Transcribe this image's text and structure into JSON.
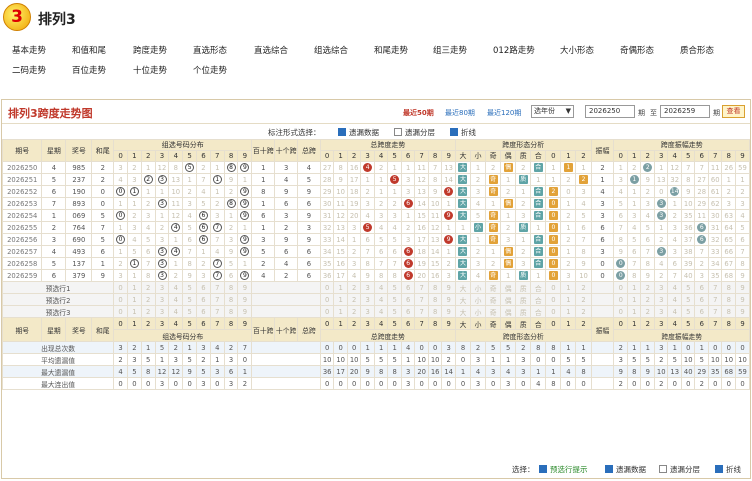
{
  "app": {
    "logo_text": "3",
    "title": "排列3"
  },
  "nav": [
    [
      "基本走势",
      "和值和尾",
      "跨度走势",
      "直选形态",
      "直选综合",
      "组选综合",
      "和尾走势",
      "组三走势",
      "012路走势",
      "大小形态",
      "奇偶形态",
      "质合形态"
    ],
    [
      "二码走势",
      "百位走势",
      "十位走势",
      "个位走势"
    ]
  ],
  "panel": {
    "title": "排列3跨度走势图",
    "quick": [
      "最近50期",
      "最近80期",
      "最近120期"
    ],
    "select": "选年份",
    "from": "2026250",
    "from_lbl": "期",
    "to_lbl": "至",
    "to": "2026259",
    "to_lbl2": "期",
    "go": "查看",
    "opt_label": "标注形式选择：",
    "options": [
      {
        "label": "遗漏数据",
        "on": true
      },
      {
        "label": "遗漏分层",
        "on": false
      },
      {
        "label": "折线",
        "on": true
      }
    ]
  },
  "headers": {
    "issue": "期号",
    "week": "星期",
    "prize": "奖号",
    "hezhi": "和尾",
    "g_zuxuan": "组选号码分布",
    "g_bs": "百十跨",
    "g_sg": "十个跨",
    "g_zk": "总跨",
    "g_zkzs": "总跨度走势",
    "g_kdxt": "跨度形态分析",
    "g_zd": "振幅",
    "g_kdzd": "跨度振幅走势",
    "digits": [
      "0",
      "1",
      "2",
      "3",
      "4",
      "5",
      "6",
      "7",
      "8",
      "9"
    ],
    "shape": [
      "大",
      "小",
      "奇",
      "偶",
      "质",
      "合",
      "0",
      "1",
      "2"
    ],
    "zd_digits": [
      "0",
      "1",
      "2",
      "3",
      "4",
      "5",
      "6",
      "7",
      "8",
      "9"
    ]
  },
  "rows": [
    {
      "issue": "2026250",
      "week": "4",
      "prize": "985",
      "hz": "2",
      "zx": [
        "3",
        "2",
        "1",
        "12",
        "8",
        "5",
        "2",
        "1",
        "8",
        "9"
      ],
      "zxc": [
        5,
        8,
        9
      ],
      "bs": "1",
      "sg": "3",
      "zk": "4",
      "kd": [
        27,
        8,
        16,
        "4",
        2,
        1,
        1,
        11,
        7,
        13
      ],
      "kdb": 3,
      "sh": [
        "大",
        "1",
        "2",
        "偶",
        "2",
        "合",
        "1",
        "1",
        "1"
      ],
      "shh": [
        0,
        3,
        5,
        7
      ],
      "zf": "2",
      "zd": [
        "1",
        "2",
        "2",
        "1",
        "12",
        "7",
        "7",
        "11",
        "26",
        "59"
      ],
      "zdb": 2
    },
    {
      "issue": "2026251",
      "week": "5",
      "prize": "237",
      "hz": "2",
      "zx": [
        "4",
        "3",
        "2",
        "3",
        "13",
        "1",
        "7",
        "1",
        "9",
        "1"
      ],
      "zxc": [
        2,
        3,
        7
      ],
      "bs": "1",
      "sg": "4",
      "zk": "5",
      "kd": [
        28,
        9,
        17,
        1,
        1,
        "5",
        3,
        12,
        8,
        14
      ],
      "kdb": 5,
      "sh": [
        "大",
        "2",
        "奇",
        "1",
        "质",
        "1",
        "1",
        "2",
        "2"
      ],
      "shh": [
        0,
        2,
        4,
        8
      ],
      "zf": "1",
      "zd": [
        "3",
        "1",
        "9",
        "13",
        "32",
        "8",
        "27",
        "60",
        "1",
        "1"
      ],
      "zdb": 1
    },
    {
      "issue": "2026252",
      "week": "6",
      "prize": "190",
      "hz": "0",
      "zx": [
        "0",
        "1",
        "1",
        "1",
        "10",
        "2",
        "4",
        "1",
        "2",
        "9"
      ],
      "zxc": [
        0,
        1,
        9
      ],
      "bs": "8",
      "sg": "9",
      "zk": "9",
      "kd": [
        29,
        10,
        18,
        2,
        1,
        1,
        3,
        13,
        9,
        "9"
      ],
      "kdb": 9,
      "sh": [
        "大",
        "3",
        "奇",
        "2",
        "1",
        "合",
        "2",
        "0",
        "3"
      ],
      "shh": [
        0,
        2,
        5,
        6
      ],
      "zf": "4",
      "zd": [
        "4",
        "1",
        "2",
        "0",
        "14",
        "9",
        "28",
        "61",
        "2",
        "2"
      ],
      "zdb": 4
    },
    {
      "issue": "2026253",
      "week": "7",
      "prize": "893",
      "hz": "0",
      "zx": [
        "1",
        "1",
        "2",
        "3",
        "11",
        "3",
        "5",
        "2",
        "8",
        "9"
      ],
      "zxc": [
        3,
        8,
        9
      ],
      "bs": "1",
      "sg": "6",
      "zk": "6",
      "kd": [
        30,
        11,
        19,
        3,
        2,
        2,
        "6",
        14,
        10,
        1
      ],
      "kdb": 6,
      "sh": [
        "大",
        "4",
        "1",
        "偶",
        "2",
        "合",
        "0",
        "1",
        "4"
      ],
      "shh": [
        0,
        3,
        5,
        6
      ],
      "zf": "3",
      "zd": [
        "5",
        "1",
        "3",
        "3",
        "1",
        "10",
        "29",
        "62",
        "3",
        "3"
      ],
      "zdb": 3
    },
    {
      "issue": "2026254",
      "week": "1",
      "prize": "069",
      "hz": "5",
      "zx": [
        "0",
        "2",
        "3",
        "1",
        "12",
        "4",
        "6",
        "3",
        "1",
        "9"
      ],
      "zxc": [
        0,
        6,
        9
      ],
      "bs": "6",
      "sg": "3",
      "zk": "9",
      "kd": [
        31,
        12,
        20,
        4,
        3,
        3,
        1,
        15,
        11,
        "9"
      ],
      "kdb": 9,
      "sh": [
        "大",
        "5",
        "奇",
        "1",
        "3",
        "合",
        "0",
        "2",
        "5"
      ],
      "shh": [
        0,
        2,
        5,
        6
      ],
      "zf": "3",
      "zd": [
        "6",
        "3",
        "4",
        "3",
        "2",
        "35",
        "11",
        "30",
        "63",
        "4"
      ],
      "zdb": 3
    },
    {
      "issue": "2026255",
      "week": "2",
      "prize": "764",
      "hz": "7",
      "zx": [
        "1",
        "3",
        "4",
        "2",
        "4",
        "5",
        "6",
        "7",
        "2",
        "1"
      ],
      "zxc": [
        4,
        6,
        7
      ],
      "bs": "1",
      "sg": "2",
      "zk": "3",
      "kd": [
        32,
        13,
        "3",
        5,
        4,
        4,
        2,
        16,
        12,
        1
      ],
      "kdb": 3,
      "sh": [
        "1",
        "小",
        "奇",
        "2",
        "质",
        "1",
        "0",
        "1",
        "6"
      ],
      "shh": [
        1,
        2,
        4,
        6
      ],
      "zf": "6",
      "zd": [
        "7",
        "4",
        "5",
        "1",
        "3",
        "36",
        "6",
        "31",
        "64",
        "5"
      ],
      "zdb": 6
    },
    {
      "issue": "2026256",
      "week": "3",
      "prize": "690",
      "hz": "5",
      "zx": [
        "0",
        "4",
        "5",
        "3",
        "1",
        "6",
        "6",
        "7",
        "3",
        "9"
      ],
      "zxc": [
        0,
        6,
        9
      ],
      "bs": "3",
      "sg": "9",
      "zk": "9",
      "kd": [
        33,
        14,
        1,
        6,
        5,
        5,
        3,
        17,
        13,
        "9"
      ],
      "kdb": 9,
      "sh": [
        "大",
        "1",
        "奇",
        "3",
        "1",
        "合",
        "0",
        "2",
        "7"
      ],
      "shh": [
        0,
        2,
        5,
        6
      ],
      "zf": "6",
      "zd": [
        "8",
        "5",
        "6",
        "2",
        "4",
        "37",
        "6",
        "32",
        "65",
        "6"
      ],
      "zdb": 6
    },
    {
      "issue": "2026257",
      "week": "4",
      "prize": "493",
      "hz": "6",
      "zx": [
        "1",
        "5",
        "6",
        "3",
        "4",
        "7",
        "1",
        "4",
        "9",
        "9"
      ],
      "zxc": [
        3,
        4,
        9
      ],
      "bs": "5",
      "sg": "6",
      "zk": "6",
      "kd": [
        34,
        15,
        2,
        7,
        6,
        6,
        "6",
        18,
        14,
        1
      ],
      "kdb": 6,
      "sh": [
        "大",
        "2",
        "1",
        "偶",
        "2",
        "合",
        "0",
        "1",
        "8"
      ],
      "shh": [
        0,
        3,
        5,
        6
      ],
      "zf": "3",
      "zd": [
        "9",
        "6",
        "7",
        "3",
        "3",
        "38",
        "7",
        "33",
        "66",
        "7"
      ],
      "zdb": 3
    },
    {
      "issue": "2026258",
      "week": "5",
      "prize": "137",
      "hz": "1",
      "zx": [
        "2",
        "1",
        "7",
        "3",
        "1",
        "8",
        "2",
        "7",
        "5",
        "1"
      ],
      "zxc": [
        1,
        3,
        7
      ],
      "bs": "2",
      "sg": "4",
      "zk": "6",
      "kd": [
        35,
        16,
        3,
        8,
        7,
        7,
        "6",
        19,
        15,
        2
      ],
      "kdb": 6,
      "sh": [
        "大",
        "3",
        "2",
        "偶",
        "3",
        "合",
        "0",
        "2",
        "9"
      ],
      "shh": [
        0,
        3,
        5,
        6
      ],
      "zf": "0",
      "zd": [
        "0",
        "7",
        "8",
        "4",
        "6",
        "39",
        "2",
        "34",
        "67",
        "8"
      ],
      "zdb": 0
    },
    {
      "issue": "2026259",
      "week": "6",
      "prize": "379",
      "hz": "9",
      "zx": [
        "3",
        "1",
        "8",
        "3",
        "2",
        "9",
        "3",
        "7",
        "6",
        "9"
      ],
      "zxc": [
        3,
        7,
        9
      ],
      "bs": "4",
      "sg": "2",
      "zk": "6",
      "kd": [
        36,
        17,
        4,
        9,
        8,
        8,
        "6",
        20,
        16,
        3
      ],
      "kdb": 6,
      "sh": [
        "大",
        "4",
        "奇",
        "1",
        "质",
        "1",
        "0",
        "3",
        "10"
      ],
      "shh": [
        0,
        2,
        4,
        6
      ],
      "zf": "0",
      "zd": [
        "0",
        "8",
        "9",
        "2",
        "7",
        "40",
        "3",
        "35",
        "68",
        "9"
      ],
      "zdb": 0
    }
  ],
  "forecast": [
    "预选行1",
    "预选行2",
    "预选行3"
  ],
  "stats": [
    {
      "label": "出现总次数",
      "zx": [
        "3",
        "2",
        "1",
        "5",
        "2",
        "1",
        "3",
        "4",
        "2",
        "7"
      ],
      "kd": [
        "0",
        "0",
        "0",
        "1",
        "1",
        "1",
        "4",
        "0",
        "0",
        "3"
      ],
      "sh": [
        "8",
        "2",
        "5",
        "5",
        "2",
        "8",
        "8",
        "1",
        "1"
      ],
      "zd": [
        "2",
        "1",
        "1",
        "3",
        "1",
        "0",
        "1",
        "0",
        "0",
        "0"
      ]
    },
    {
      "label": "平均遗漏值",
      "zx": [
        "2",
        "3",
        "5",
        "1",
        "3",
        "5",
        "2",
        "1",
        "3",
        "0"
      ],
      "kd": [
        "10",
        "10",
        "10",
        "5",
        "5",
        "5",
        "1",
        "10",
        "10",
        "2"
      ],
      "sh": [
        "0",
        "3",
        "1",
        "1",
        "3",
        "0",
        "0",
        "5",
        "5"
      ],
      "zd": [
        "3",
        "5",
        "5",
        "2",
        "5",
        "10",
        "5",
        "10",
        "10",
        "10"
      ]
    },
    {
      "label": "最大遗漏值",
      "zx": [
        "4",
        "5",
        "8",
        "12",
        "12",
        "9",
        "5",
        "3",
        "6",
        "1"
      ],
      "kd": [
        "36",
        "17",
        "20",
        "9",
        "8",
        "8",
        "3",
        "20",
        "16",
        "14"
      ],
      "sh": [
        "1",
        "4",
        "3",
        "4",
        "3",
        "1",
        "1",
        "4",
        "8"
      ],
      "zd": [
        "9",
        "8",
        "9",
        "10",
        "13",
        "40",
        "29",
        "35",
        "68",
        "59"
      ]
    },
    {
      "label": "最大连出值",
      "zx": [
        "0",
        "0",
        "0",
        "3",
        "0",
        "0",
        "3",
        "0",
        "3",
        "2"
      ],
      "kd": [
        "0",
        "0",
        "0",
        "0",
        "0",
        "0",
        "3",
        "0",
        "0",
        "0"
      ],
      "sh": [
        "0",
        "3",
        "0",
        "3",
        "0",
        "4",
        "8",
        "0",
        "0"
      ],
      "zd": [
        "2",
        "0",
        "0",
        "2",
        "0",
        "0",
        "2",
        "0",
        "0",
        "0"
      ]
    }
  ],
  "bottom": {
    "label": "选择：",
    "options": [
      {
        "label": "预选行提示",
        "on": true,
        "color": "#2a8a2a"
      },
      {
        "label": "遗漏数据",
        "on": true
      },
      {
        "label": "遗漏分层",
        "on": false
      },
      {
        "label": "折线",
        "on": true
      }
    ]
  },
  "colors": {
    "accent": "#c0392b",
    "link": "#2a6ebb",
    "header_bg": "#f3e9c8"
  }
}
